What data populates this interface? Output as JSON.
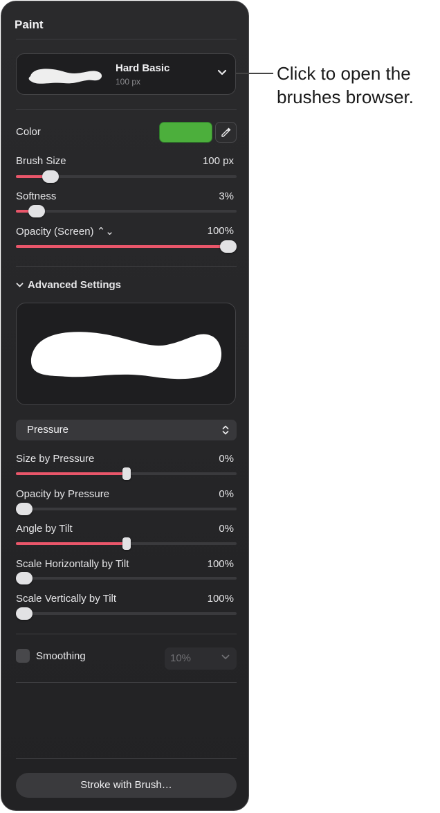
{
  "panel": {
    "title": "Paint",
    "brush": {
      "name": "Hard Basic",
      "size": "100 px"
    },
    "color": {
      "label": "Color",
      "swatch": "#4caf3c",
      "eyedropper_icon": "eyedropper-icon"
    },
    "sliders": {
      "brush_size": {
        "label": "Brush Size",
        "value": "100 px",
        "fraction": 0.13
      },
      "softness": {
        "label": "Softness",
        "value": "3%",
        "fraction": 0.06
      },
      "opacity": {
        "label": "Opacity (Screen) ⌃⌄",
        "value": "100%",
        "fraction": 1.0
      }
    },
    "advanced": {
      "label": "Advanced Settings",
      "mode": "Pressure",
      "sliders": {
        "size_by_pressure": {
          "label": "Size by Pressure",
          "value": "0%",
          "fraction": 0.5
        },
        "opacity_by_pressure": {
          "label": "Opacity by Pressure",
          "value": "0%",
          "fraction": 0.0
        },
        "angle_by_tilt": {
          "label": "Angle by Tilt",
          "value": "0%",
          "fraction": 0.5
        },
        "scale_h_by_tilt": {
          "label": "Scale Horizontally by Tilt",
          "value": "100%",
          "fraction": 0.0
        },
        "scale_v_by_tilt": {
          "label": "Scale Vertically by Tilt",
          "value": "100%",
          "fraction": 0.0
        }
      }
    },
    "smoothing": {
      "label": "Smoothing",
      "checked": false,
      "value": "10%"
    },
    "stroke_button": "Stroke with Brush…"
  },
  "callout": {
    "line1": "Click to open the",
    "line2": "brushes browser."
  },
  "colors": {
    "accent": "#e9566a",
    "panel_bg": "#252527",
    "swatch": "#4caf3c"
  }
}
